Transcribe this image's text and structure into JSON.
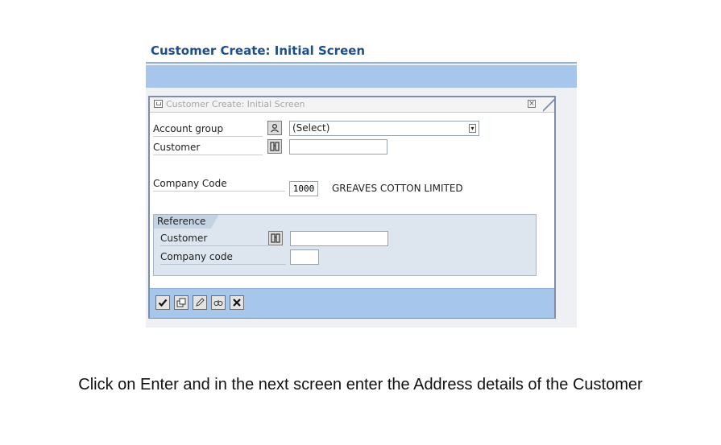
{
  "screen": {
    "title": "Customer Create: Initial Screen"
  },
  "dialog": {
    "title": "Customer Create: Initial Screen",
    "close_icon": "close-icon",
    "fields": {
      "account_group_label": "Account group",
      "account_group_value": "(Select)",
      "customer_label": "Customer",
      "customer_value": "",
      "company_code_label": "Company Code",
      "company_code_value": "1000",
      "company_name": "GREAVES COTTON LIMITED"
    },
    "reference": {
      "title": "Reference",
      "customer_label": "Customer",
      "customer_value": "",
      "company_code_label": "Company code",
      "company_code_value": ""
    },
    "footer_buttons": [
      {
        "name": "enter-button",
        "icon": "check-icon"
      },
      {
        "name": "all-screens-button",
        "icon": "screens-icon"
      },
      {
        "name": "edit-button",
        "icon": "pencil-icon"
      },
      {
        "name": "search-button",
        "icon": "binoculars-icon"
      },
      {
        "name": "cancel-button",
        "icon": "x-icon"
      }
    ]
  },
  "caption": "Click on Enter and in the next screen enter the Address details of the Customer",
  "colors": {
    "title_blue": "#1f4e8c",
    "bar_blue": "#a7c6ec",
    "group_blue": "#dde6ef"
  }
}
